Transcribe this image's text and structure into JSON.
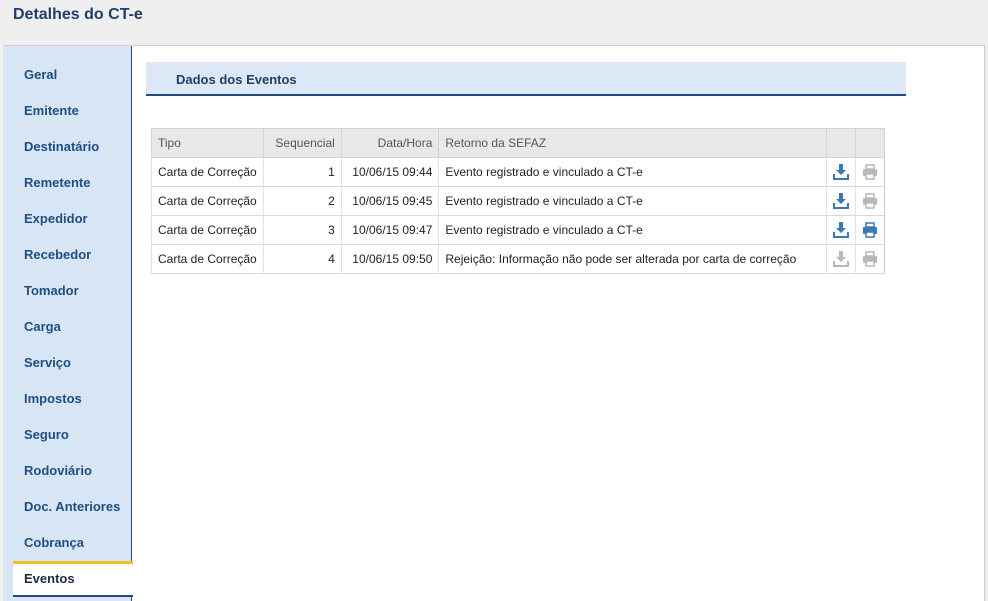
{
  "page": {
    "title": "Detalhes do CT-e"
  },
  "sidebar": {
    "items": [
      {
        "label": "Geral"
      },
      {
        "label": "Emitente"
      },
      {
        "label": "Destinatário"
      },
      {
        "label": "Remetente"
      },
      {
        "label": "Expedidor"
      },
      {
        "label": "Recebedor"
      },
      {
        "label": "Tomador"
      },
      {
        "label": "Carga"
      },
      {
        "label": "Serviço"
      },
      {
        "label": "Impostos"
      },
      {
        "label": "Seguro"
      },
      {
        "label": "Rodoviário"
      },
      {
        "label": "Doc. Anteriores"
      },
      {
        "label": "Cobrança"
      },
      {
        "label": "Eventos",
        "active": true
      }
    ]
  },
  "section": {
    "title": "Dados dos Eventos"
  },
  "table": {
    "headers": {
      "tipo": "Tipo",
      "sequencial": "Sequencial",
      "data_hora": "Data/Hora",
      "retorno": "Retorno da SEFAZ"
    },
    "rows": [
      {
        "tipo": "Carta de Correção",
        "sequencial": "1",
        "data_hora": "10/06/15 09:44",
        "retorno": "Evento registrado e vinculado a CT-e",
        "download_enabled": true,
        "print_enabled": false
      },
      {
        "tipo": "Carta de Correção",
        "sequencial": "2",
        "data_hora": "10/06/15 09:45",
        "retorno": "Evento registrado e vinculado a CT-e",
        "download_enabled": true,
        "print_enabled": false
      },
      {
        "tipo": "Carta de Correção",
        "sequencial": "3",
        "data_hora": "10/06/15 09:47",
        "retorno": "Evento registrado e vinculado a CT-e",
        "download_enabled": true,
        "print_enabled": true
      },
      {
        "tipo": "Carta de Correção",
        "sequencial": "4",
        "data_hora": "10/06/15 09:50",
        "retorno": "Rejeição: Informação não pode ser alterada por carta de correção",
        "download_enabled": false,
        "print_enabled": false
      }
    ]
  },
  "icons": {
    "download": "download-icon",
    "print": "printer-icon"
  },
  "colors": {
    "accent": "#1e4c7e",
    "active_marker": "#f1c21b",
    "icon_enabled": "#3a78b8",
    "icon_disabled": "#b8b8b8"
  }
}
